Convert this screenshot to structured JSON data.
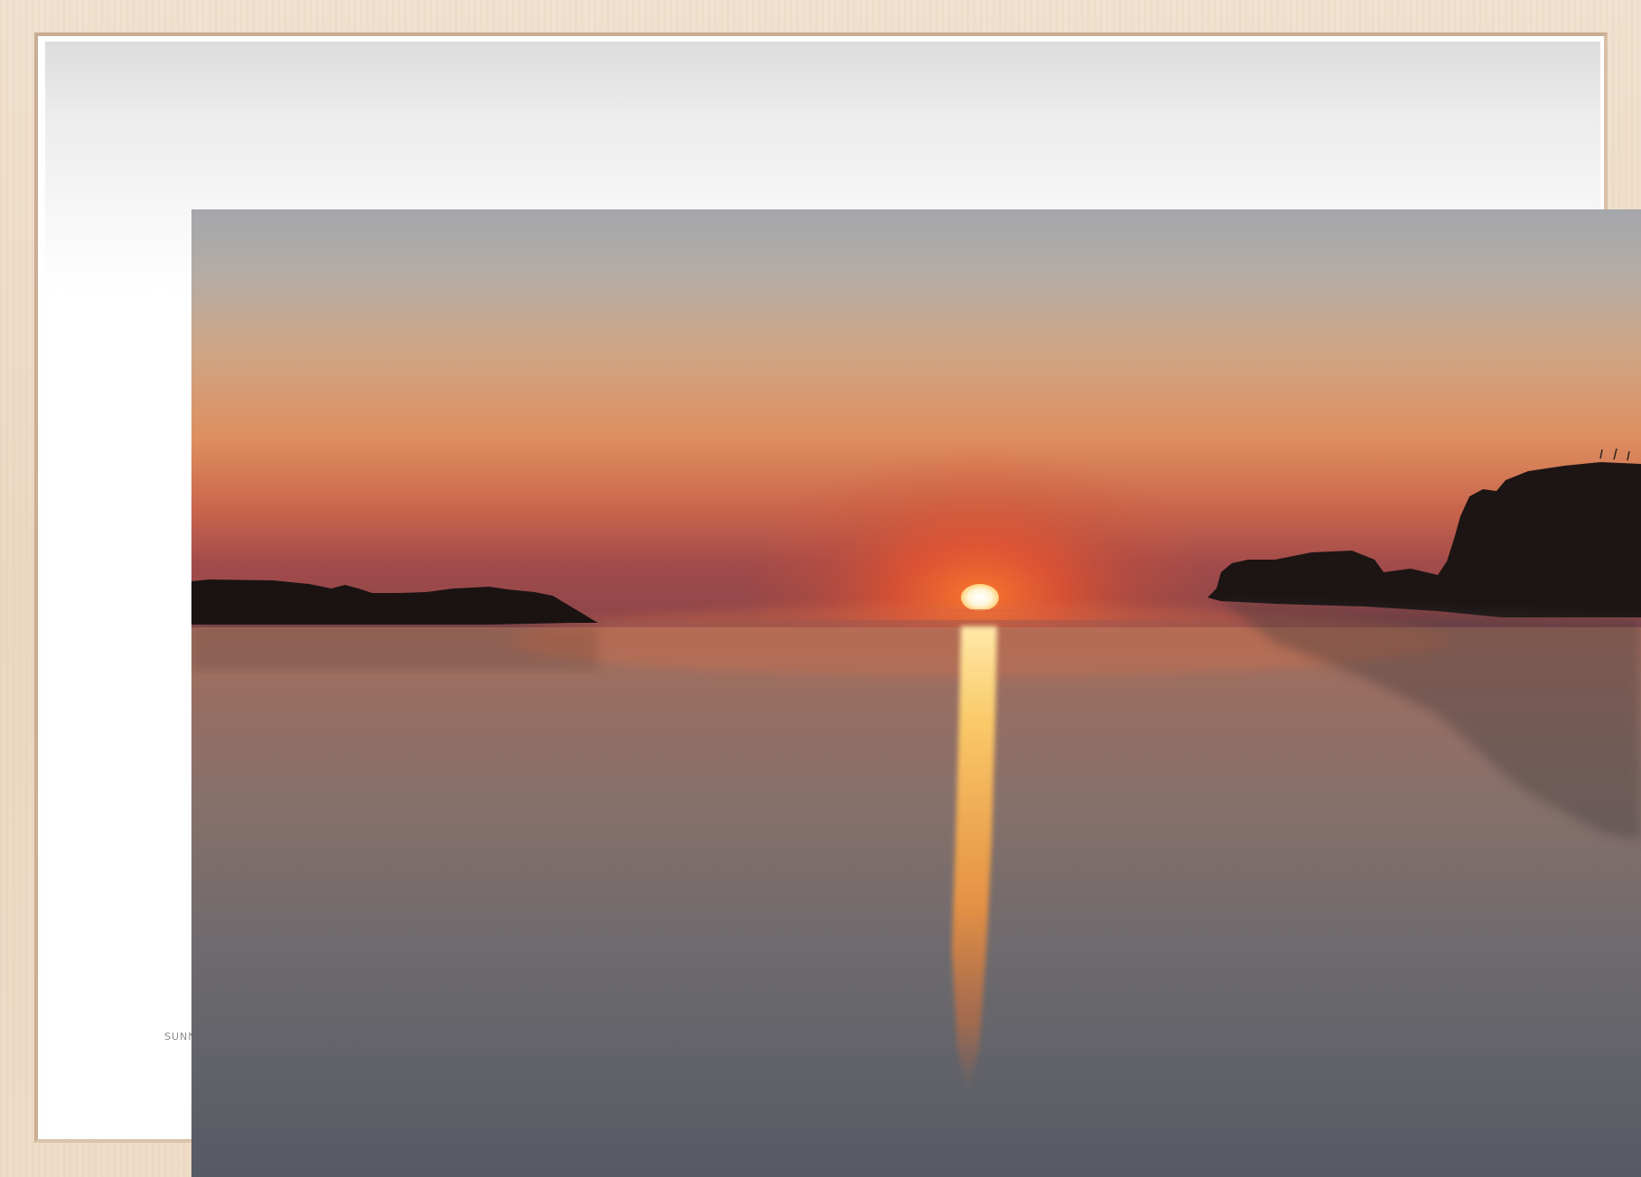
{
  "scene": {
    "subject": "sunset-over-calm-sea",
    "colors": {
      "frame_wood": "#ecd8c2",
      "sky_top": "#a6a7ab",
      "sky_horizon": "#e2562a",
      "sun": "#fff8e0",
      "water": "#5a5d66",
      "silhouette": "#1b1312"
    }
  },
  "print_caption": "SUNN"
}
